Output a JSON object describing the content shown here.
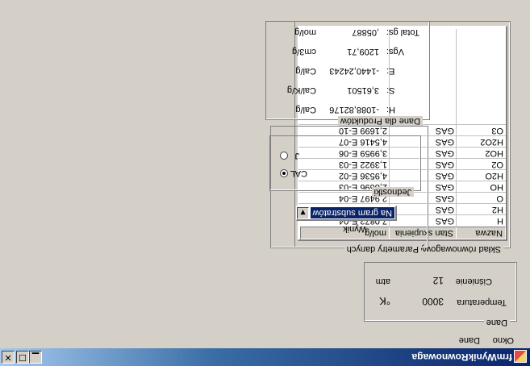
{
  "window": {
    "title": "frmWynikRownowaga",
    "controls": {
      "minimize": "▁",
      "maximize": "☐",
      "close": "✕"
    }
  },
  "menu": {
    "items": [
      "Okno",
      "Dane"
    ]
  },
  "dane": {
    "group_label": "Dane",
    "temperature_label": "Temperatura",
    "temperature_value": "3000",
    "temperature_unit": "°K",
    "pressure_label": "Ciśnienie",
    "pressure_value": "12",
    "pressure_unit": "atm"
  },
  "equilibrium": {
    "group_label": "Skład równowagowy",
    "columns": [
      "Nazwa",
      "Stan skupienia",
      "mol/g"
    ],
    "rows": [
      [
        "H",
        "GAS",
        "7,0872 E-04"
      ],
      [
        "H2",
        "GAS",
        "4,1663 E-03"
      ],
      [
        "O",
        "GAS",
        "2,9497 E-04"
      ],
      [
        "HO",
        "GAS",
        "2,8696 E-03"
      ],
      [
        "H2O",
        "GAS",
        "4,9536 E-02"
      ],
      [
        "O2",
        "GAS",
        "1,3922 E-03"
      ],
      [
        "HO2",
        "GAS",
        "3,9959 E-06"
      ],
      [
        "H2O2",
        "GAS",
        "4,5416 E-07"
      ],
      [
        "O3",
        "GAS",
        "2,1699 E-10"
      ]
    ]
  },
  "parameters": {
    "group_label": "Parametry danych",
    "output_label": "Wynik",
    "output_selected": "Na gram substratów",
    "units_group_label": "Jednostki",
    "units_options": [
      {
        "label": "CAL",
        "selected": true
      },
      {
        "label": "J",
        "selected": false
      }
    ]
  },
  "products": {
    "group_label": "Dane dla Produktów",
    "rows": [
      {
        "label": "H:",
        "value": "-1088,82176",
        "unit": "Cal/g"
      },
      {
        "label": "S:",
        "value": "3,61501",
        "unit": "Cal/K/g"
      },
      {
        "label": "E:",
        "value": "-1440,24243",
        "unit": "Cal/g"
      },
      {
        "label": "Vgs:",
        "value": "1209,71",
        "unit": "cm3/g"
      },
      {
        "label": "Total gs:",
        "value": ",05887",
        "unit": "mol/g"
      }
    ]
  }
}
